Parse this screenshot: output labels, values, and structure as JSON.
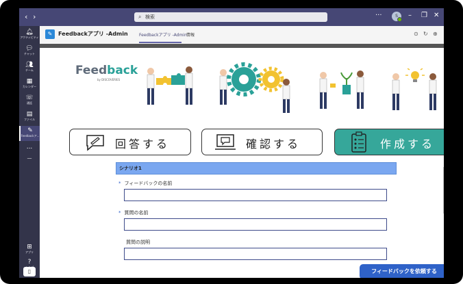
{
  "titlebar": {
    "search_placeholder": "検索",
    "avatar_initials": "S"
  },
  "rail": {
    "items": [
      {
        "label": "アクティビティ",
        "icon": "bell-icon"
      },
      {
        "label": "チャット",
        "icon": "chat-icon"
      },
      {
        "label": "チーム",
        "icon": "teams-icon"
      },
      {
        "label": "カレンダー",
        "icon": "calendar-icon"
      },
      {
        "label": "通話",
        "icon": "phone-icon"
      },
      {
        "label": "ファイル",
        "icon": "file-icon"
      },
      {
        "label": "Feedbackア...",
        "icon": "app-icon"
      },
      {
        "label": "...",
        "icon": "more-icon"
      },
      {
        "label": "アプリ",
        "icon": "apps-icon"
      },
      {
        "label": "ヘルプ",
        "icon": "help-icon"
      }
    ]
  },
  "app_header": {
    "app_name": "Feedbackアプリ -Admin",
    "tabs": [
      "Feedbackアプリ -Admin",
      "情報"
    ]
  },
  "logo": {
    "text_main": "Feed",
    "text_accent": "back",
    "byline": "by DISCOVERIES"
  },
  "actions": [
    {
      "label": "回答する"
    },
    {
      "label": "確認する"
    },
    {
      "label": "作成する"
    }
  ],
  "form": {
    "scenario_title": "シナリオ1",
    "field1_label": "フィードバックの名前",
    "field2_label": "質問の名前",
    "field3_label": "質問の説明",
    "required_mark": "*",
    "submit_label": "フィードバックを依頼する"
  },
  "colors": {
    "teams_purple": "#464775",
    "accent_teal": "#36a79a",
    "scenario_blue": "#7aa7f0",
    "submit_blue": "#2f62c8"
  }
}
